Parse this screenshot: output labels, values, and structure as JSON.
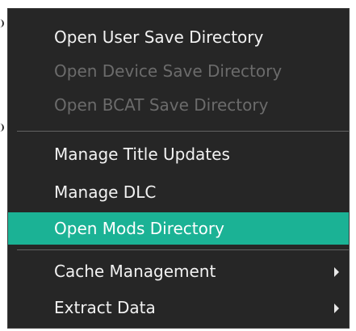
{
  "context_menu": {
    "items": [
      {
        "label": "Open User Save Directory",
        "enabled": true
      },
      {
        "label": "Open Device Save Directory",
        "enabled": false
      },
      {
        "label": "Open BCAT Save Directory",
        "enabled": false
      },
      {
        "label": "Manage Title Updates",
        "enabled": true
      },
      {
        "label": "Manage DLC",
        "enabled": true
      },
      {
        "label": "Open Mods Directory",
        "enabled": true,
        "selected": true
      },
      {
        "label": "Cache Management",
        "enabled": true,
        "submenu": true
      },
      {
        "label": "Extract Data",
        "enabled": true,
        "submenu": true
      }
    ]
  },
  "colors": {
    "menu_background": "#262626",
    "text": "#f2f2f2",
    "disabled_text": "#6b6b6b",
    "selection": "#1bb295",
    "separator": "#626262"
  },
  "icons": {
    "submenu_arrow": "triangle-right-icon"
  }
}
